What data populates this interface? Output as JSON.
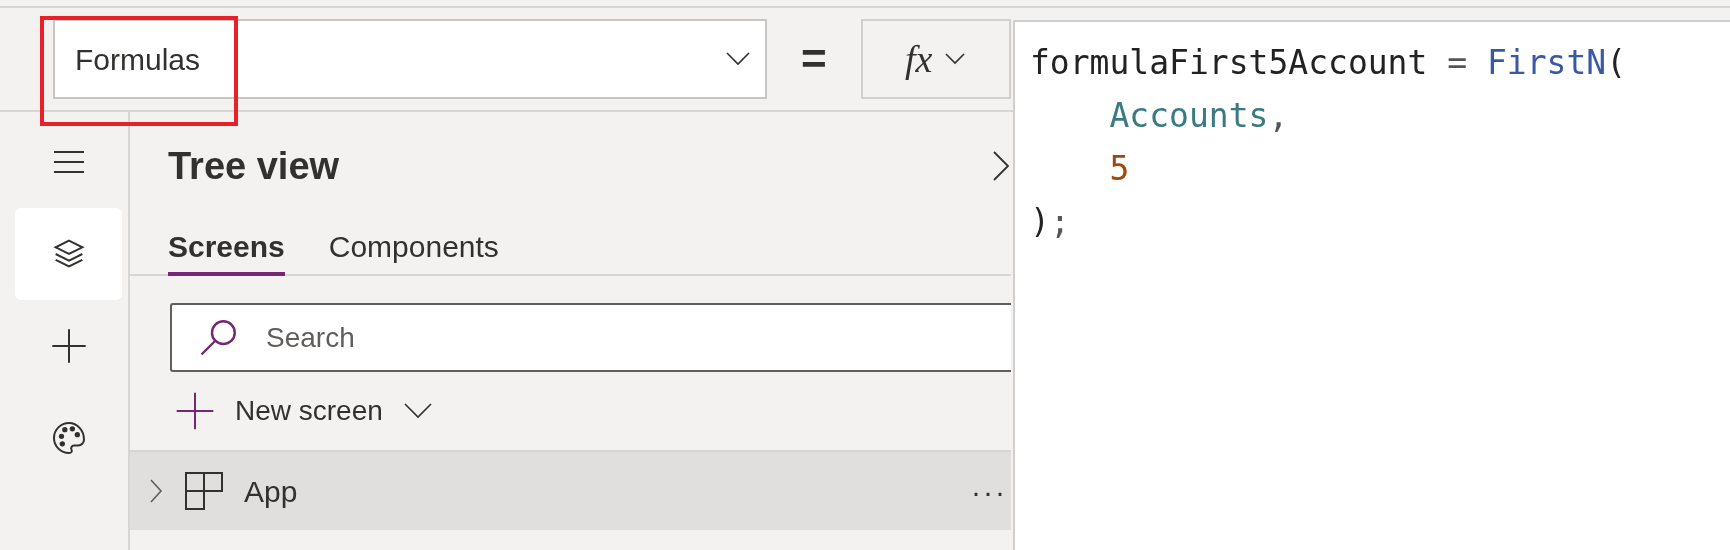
{
  "formula_bar": {
    "property": "Formulas",
    "highlighted": true,
    "equals": "=",
    "fx": "fx"
  },
  "code_editor": {
    "lines": [
      {
        "tokens": [
          {
            "kind": "plain",
            "text": "formulaFirst5Account"
          },
          {
            "kind": "operator",
            "text": " = "
          },
          {
            "kind": "function",
            "text": "FirstN"
          },
          {
            "kind": "plain",
            "text": "("
          }
        ]
      },
      {
        "tokens": [
          {
            "kind": "table",
            "text": "    Accounts"
          },
          {
            "kind": "operator",
            "text": ","
          }
        ]
      },
      {
        "tokens": [
          {
            "kind": "number",
            "text": "    5"
          }
        ]
      },
      {
        "tokens": [
          {
            "kind": "plain",
            "text": ")"
          },
          {
            "kind": "operator",
            "text": ";"
          }
        ]
      }
    ]
  },
  "rail": [
    {
      "kind": "menu",
      "selected": false
    },
    {
      "kind": "layers",
      "selected": true
    },
    {
      "kind": "add",
      "selected": false
    },
    {
      "kind": "palette",
      "selected": false
    }
  ],
  "tree_view": {
    "title": "Tree view",
    "tabs": [
      {
        "label": "Screens",
        "selected": true
      },
      {
        "label": "Components",
        "selected": false
      }
    ],
    "search": {
      "placeholder": "Search"
    },
    "new_screen": "New screen",
    "items": [
      {
        "label": "App",
        "expanded": false,
        "more": "···"
      }
    ]
  }
}
